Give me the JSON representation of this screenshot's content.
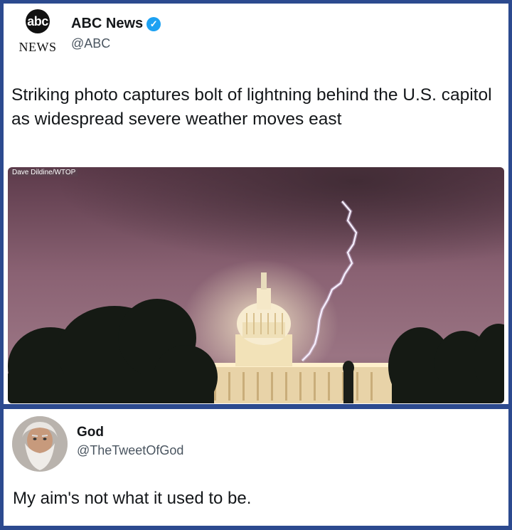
{
  "tweet1": {
    "logo": {
      "top": "abc",
      "bottom": "NEWS"
    },
    "name": "ABC News",
    "verified_icon": "✓",
    "handle": "@ABC",
    "text": "Striking photo captures bolt of lightning behind the U.S. capitol as widespread severe weather moves east",
    "photo_credit": "Dave Dildine/WTOP"
  },
  "tweet2": {
    "name": "God",
    "handle": "@TheTweetOfGod",
    "text": "My aim's not what it used to be."
  },
  "colors": {
    "frame": "#2c4a8f",
    "verified": "#1da1f2"
  }
}
